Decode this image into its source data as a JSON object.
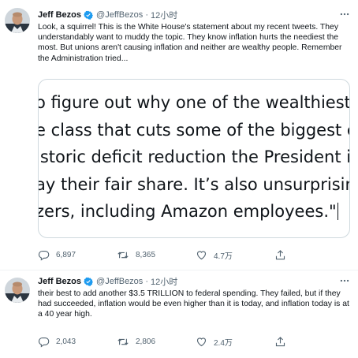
{
  "tweets": [
    {
      "author": {
        "name": "Jeff Bezos",
        "handle": "@JeffBezos",
        "separator": "·",
        "time": "12小时"
      },
      "text": "Look, a squirrel! This is the White House's statement about my recent tweets. They understandably want to muddy the topic. They know inflation hurts the neediest the most. But unions aren't causing inflation and neither are wealthy people.  Remember the Administration tried...",
      "media": {
        "lines": [
          "o figure out why one of the wealthiest indivi",
          "e class that cuts some of the biggest costs fa",
          "istoric deficit reduction the President is ach",
          "ay their fair share. It’s also unsurprising tha",
          "zers, including Amazon employees.\""
        ]
      },
      "actions": {
        "replies": "6,897",
        "retweets": "8,365",
        "likes": "4.7万"
      }
    },
    {
      "author": {
        "name": "Jeff Bezos",
        "handle": "@JeffBezos",
        "separator": "·",
        "time": "12小时"
      },
      "text": "their best to add another $3.5 TRILLION to federal spending. They failed, but if they had succeeded, inflation would be even higher than it is today, and inflation today is at a 40 year high.",
      "actions": {
        "replies": "2,043",
        "retweets": "2,806",
        "likes": "2.4万"
      }
    }
  ],
  "icons": [
    "verified-badge-icon",
    "more-icon",
    "reply-icon",
    "retweet-icon",
    "like-icon",
    "share-icon"
  ],
  "colors": {
    "verified": "#1d9bf0",
    "secondary_text": "#536471",
    "border": "#cfd9de"
  }
}
